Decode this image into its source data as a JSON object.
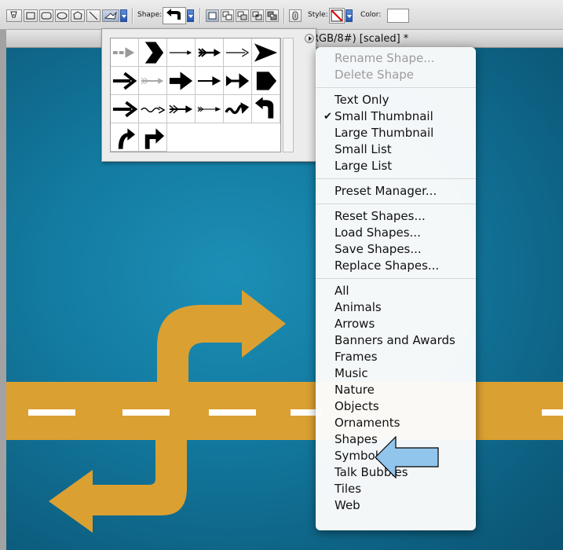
{
  "options_bar": {
    "shape_label": "Shape:",
    "style_label": "Style:",
    "color_label": "Color:",
    "color_value": "#ffffff"
  },
  "document": {
    "title": "RGB/8#) [scaled] *"
  },
  "shape_picker": {
    "shapes": [
      "arrow-dashed",
      "arrow-chevron",
      "arrow-thin-line",
      "arrow-fletched-line",
      "arrow-thin-line-2",
      "arrow-triangle-head",
      "arrow-bold",
      "arrow-feathered-gray",
      "arrow-bold-short",
      "arrow-thin-line-3",
      "arrow-fletched-bold",
      "arrow-block-pentagon",
      "arrow-bold-2",
      "arrow-wavy",
      "arrow-fletched-long",
      "arrow-feathered-long",
      "arrow-squiggle",
      "arrow-uturn",
      "arrow-curved-turn",
      "arrow-right-angle-turn"
    ]
  },
  "menu": {
    "groups": [
      [
        {
          "label": "Rename Shape...",
          "disabled": true
        },
        {
          "label": "Delete Shape",
          "disabled": true
        }
      ],
      [
        {
          "label": "Text Only"
        },
        {
          "label": "Small Thumbnail",
          "checked": true
        },
        {
          "label": "Large Thumbnail"
        },
        {
          "label": "Small List"
        },
        {
          "label": "Large List"
        }
      ],
      [
        {
          "label": "Preset Manager..."
        }
      ],
      [
        {
          "label": "Reset Shapes..."
        },
        {
          "label": "Load Shapes..."
        },
        {
          "label": "Save Shapes..."
        },
        {
          "label": "Replace Shapes..."
        }
      ],
      [
        {
          "label": "All"
        },
        {
          "label": "Animals"
        },
        {
          "label": "Arrows"
        },
        {
          "label": "Banners and Awards"
        },
        {
          "label": "Frames"
        },
        {
          "label": "Music"
        },
        {
          "label": "Nature"
        },
        {
          "label": "Objects"
        },
        {
          "label": "Ornaments"
        },
        {
          "label": "Shapes"
        },
        {
          "label": "Symbols"
        },
        {
          "label": "Talk Bubbles"
        },
        {
          "label": "Tiles"
        },
        {
          "label": "Web"
        }
      ]
    ]
  },
  "colors": {
    "canvas": "#137aa0",
    "road": "#dba032",
    "pointer_fill": "#92c5ec",
    "check_mark": "checkmark-icon"
  }
}
